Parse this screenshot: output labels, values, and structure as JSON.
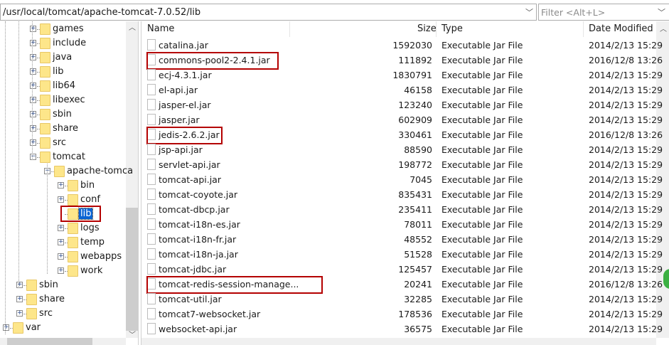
{
  "path_bar": {
    "value": "/usr/local/tomcat/apache-tomcat-7.0.52/lib"
  },
  "filter": {
    "placeholder": "Filter <Alt+L>"
  },
  "tree": [
    {
      "label": "games",
      "level": 2,
      "expander": "+"
    },
    {
      "label": "include",
      "level": 2,
      "expander": "+"
    },
    {
      "label": "java",
      "level": 2,
      "expander": "+"
    },
    {
      "label": "lib",
      "level": 2,
      "expander": "+"
    },
    {
      "label": "lib64",
      "level": 2,
      "expander": "+"
    },
    {
      "label": "libexec",
      "level": 2,
      "expander": "+"
    },
    {
      "label": "sbin",
      "level": 2,
      "expander": "+"
    },
    {
      "label": "share",
      "level": 2,
      "expander": "+"
    },
    {
      "label": "src",
      "level": 2,
      "expander": "+"
    },
    {
      "label": "tomcat",
      "level": 2,
      "expander": "-"
    },
    {
      "label": "apache-tomca",
      "level": 3,
      "expander": "-"
    },
    {
      "label": "bin",
      "level": 4,
      "expander": "+"
    },
    {
      "label": "conf",
      "level": 4,
      "expander": "+"
    },
    {
      "label": "lib",
      "level": 4,
      "expander": "",
      "selected": true,
      "highlighted": true
    },
    {
      "label": "logs",
      "level": 4,
      "expander": "+"
    },
    {
      "label": "temp",
      "level": 4,
      "expander": "+"
    },
    {
      "label": "webapps",
      "level": 4,
      "expander": "+"
    },
    {
      "label": "work",
      "level": 4,
      "expander": "+"
    },
    {
      "label": "sbin",
      "level": 1,
      "expander": "+"
    },
    {
      "label": "share",
      "level": 1,
      "expander": "+"
    },
    {
      "label": "src",
      "level": 1,
      "expander": "+"
    },
    {
      "label": "var",
      "level": 0,
      "expander": "+"
    }
  ],
  "columns": {
    "name": "Name",
    "size": "Size",
    "type": "Type",
    "date": "Date Modified"
  },
  "files": [
    {
      "name": "catalina.jar",
      "size": "1592030",
      "type": "Executable Jar File",
      "date": "2014/2/13 15:29"
    },
    {
      "name": "commons-pool2-2.4.1.jar",
      "size": "111892",
      "type": "Executable Jar File",
      "date": "2016/12/8 13:26",
      "highlighted": true
    },
    {
      "name": "ecj-4.3.1.jar",
      "size": "1830791",
      "type": "Executable Jar File",
      "date": "2014/2/13 15:29"
    },
    {
      "name": "el-api.jar",
      "size": "46158",
      "type": "Executable Jar File",
      "date": "2014/2/13 15:29"
    },
    {
      "name": "jasper-el.jar",
      "size": "123240",
      "type": "Executable Jar File",
      "date": "2014/2/13 15:29"
    },
    {
      "name": "jasper.jar",
      "size": "602909",
      "type": "Executable Jar File",
      "date": "2014/2/13 15:29"
    },
    {
      "name": "jedis-2.6.2.jar",
      "size": "330461",
      "type": "Executable Jar File",
      "date": "2016/12/8 13:26",
      "highlighted": true
    },
    {
      "name": "jsp-api.jar",
      "size": "88590",
      "type": "Executable Jar File",
      "date": "2014/2/13 15:29"
    },
    {
      "name": "servlet-api.jar",
      "size": "198772",
      "type": "Executable Jar File",
      "date": "2014/2/13 15:29"
    },
    {
      "name": "tomcat-api.jar",
      "size": "7045",
      "type": "Executable Jar File",
      "date": "2014/2/13 15:29"
    },
    {
      "name": "tomcat-coyote.jar",
      "size": "835431",
      "type": "Executable Jar File",
      "date": "2014/2/13 15:29"
    },
    {
      "name": "tomcat-dbcp.jar",
      "size": "235411",
      "type": "Executable Jar File",
      "date": "2014/2/13 15:29"
    },
    {
      "name": "tomcat-i18n-es.jar",
      "size": "78011",
      "type": "Executable Jar File",
      "date": "2014/2/13 15:29"
    },
    {
      "name": "tomcat-i18n-fr.jar",
      "size": "48552",
      "type": "Executable Jar File",
      "date": "2014/2/13 15:29"
    },
    {
      "name": "tomcat-i18n-ja.jar",
      "size": "51528",
      "type": "Executable Jar File",
      "date": "2014/2/13 15:29"
    },
    {
      "name": "tomcat-jdbc.jar",
      "size": "125457",
      "type": "Executable Jar File",
      "date": "2014/2/13 15:29"
    },
    {
      "name": "tomcat-redis-session-manage...",
      "size": "20241",
      "type": "Executable Jar File",
      "date": "2016/12/8 13:26",
      "highlighted": true
    },
    {
      "name": "tomcat-util.jar",
      "size": "32285",
      "type": "Executable Jar File",
      "date": "2014/2/13 15:29"
    },
    {
      "name": "tomcat7-websocket.jar",
      "size": "178536",
      "type": "Executable Jar File",
      "date": "2014/2/13 15:29"
    },
    {
      "name": "websocket-api.jar",
      "size": "36575",
      "type": "Executable Jar File",
      "date": "2014/2/13 15:29"
    }
  ],
  "colors": {
    "highlight": "#b40000",
    "selection": "#0a64d4",
    "folder": "#fde68a"
  }
}
